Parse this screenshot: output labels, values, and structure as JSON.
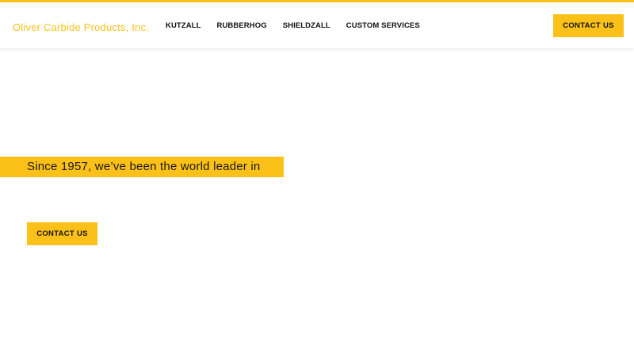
{
  "colors": {
    "accent": "#fbc119",
    "text_dark": "#111111",
    "background": "#ffffff"
  },
  "header": {
    "logo_text": "Oliver Carbide Products, Inc.",
    "nav": [
      {
        "label": "KUTZALL"
      },
      {
        "label": "RUBBERHOG"
      },
      {
        "label": "SHIELDZALL"
      },
      {
        "label": "CUSTOM SERVICES"
      }
    ],
    "cta_label": "CONTACT US"
  },
  "hero": {
    "tagline": "Since 1957, we’ve been the world leader in",
    "cta_label": "CONTACT US"
  }
}
